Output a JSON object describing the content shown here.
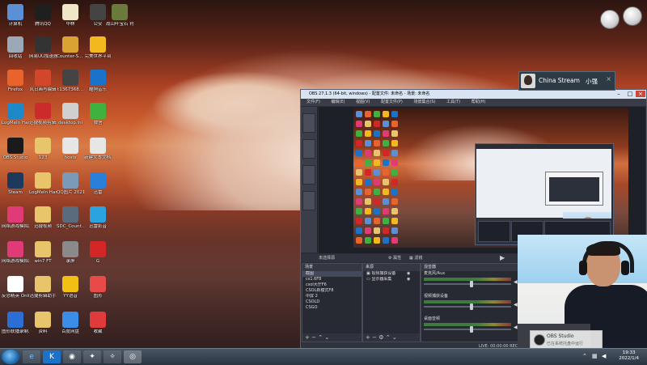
{
  "desktop_icons": [
    {
      "label": "计算机",
      "icon": "computer-icon",
      "color": "#5b8fd6"
    },
    {
      "label": "腾讯QQ",
      "icon": "qq-icon",
      "color": "#1f1f1f"
    },
    {
      "label": "中林",
      "icon": "doc-icon",
      "color": "#f0e6c8"
    },
    {
      "label": "公安",
      "icon": "app-icon",
      "color": "#444"
    },
    {
      "label": "战山叶宝石 衬面.png",
      "icon": "image-icon",
      "color": "#6a7a3a"
    },
    {
      "label": "回收站",
      "icon": "recycle-bin-icon",
      "color": "#9aa8b8"
    },
    {
      "label": "网易UU加速器",
      "icon": "uu-icon",
      "color": "#333"
    },
    {
      "label": "Counter-S... Global Off...",
      "icon": "csgo-icon",
      "color": "#d9a233"
    },
    {
      "label": "完美世界平台",
      "icon": "perfect-world-icon",
      "color": "#f2b81e"
    },
    {
      "label": "Firefox",
      "icon": "firefox-icon",
      "color": "#e8642c"
    },
    {
      "label": "风日画与编辑",
      "icon": "paint-icon",
      "color": "#d2472c"
    },
    {
      "label": "t1367368...",
      "icon": "image-icon",
      "color": "#444"
    },
    {
      "label": "酷狗音乐",
      "icon": "kugou-icon",
      "color": "#1a73c9"
    },
    {
      "label": "LogMeIn Hamachi",
      "icon": "hamachi-icon",
      "color": "#1e88c9"
    },
    {
      "label": "迅捷视频剪辑软件",
      "icon": "video-edit-icon",
      "color": "#cc2b2b"
    },
    {
      "label": "desktop.ini",
      "icon": "file-icon",
      "color": "#d0d0d0"
    },
    {
      "label": "微信",
      "icon": "wechat-icon",
      "color": "#3fb13f"
    },
    {
      "label": "OBS Studio",
      "icon": "obs-icon",
      "color": "#1a1a1a"
    },
    {
      "label": "123",
      "icon": "folder-icon",
      "color": "#e8c46a"
    },
    {
      "label": "hosts",
      "icon": "file-icon",
      "color": "#e6e6e6"
    },
    {
      "label": "新建文本文档.txt",
      "icon": "text-file-icon",
      "color": "#e6e6e6"
    },
    {
      "label": "Steam",
      "icon": "steam-icon",
      "color": "#1d3a5c"
    },
    {
      "label": "LogMeIn Hamachi",
      "icon": "hamachi-icon",
      "color": "#e8c46a"
    },
    {
      "label": "QQ图片 20211212...",
      "icon": "image-icon",
      "color": "#7a9ab8"
    },
    {
      "label": "迅雷",
      "icon": "xunlei-icon",
      "color": "#2a7fd8"
    },
    {
      "label": "网络游戏模拟器工具",
      "icon": "game-tool-icon",
      "color": "#e03a77"
    },
    {
      "label": "迅捷视频",
      "icon": "folder-icon",
      "color": "#e8c46a"
    },
    {
      "label": "SDC_Count... Online",
      "icon": "cs-online-icon",
      "color": "#5a6b7d"
    },
    {
      "label": "迅雷影音",
      "icon": "xunlei-player-icon",
      "color": "#2aa3e0"
    },
    {
      "label": "网络游戏模拟器",
      "icon": "game-tool-icon",
      "color": "#e03a77"
    },
    {
      "label": "win7 FT",
      "icon": "folder-icon",
      "color": "#e8c46a"
    },
    {
      "label": "录屏",
      "icon": "record-icon",
      "color": "#8a8a8a"
    },
    {
      "label": "G",
      "icon": "g-app-icon",
      "color": "#d42626"
    },
    {
      "label": "反恐精英 Online",
      "icon": "cs-online-icon",
      "color": "#ffffff"
    },
    {
      "label": "迅捷剪辑助手",
      "icon": "folder-icon",
      "color": "#e8c46a"
    },
    {
      "label": "YY语音",
      "icon": "yy-icon",
      "color": "#f2c014"
    },
    {
      "label": "图形",
      "icon": "paint-icon",
      "color": "#e84a4a"
    },
    {
      "label": "图形联播录制工具",
      "icon": "ocam-icon",
      "color": "#2b6ed4"
    },
    {
      "label": "资料",
      "icon": "folder-icon",
      "color": "#e8c46a"
    },
    {
      "label": "百度网盘",
      "icon": "baidu-pan-icon",
      "color": "#3a8ee8"
    },
    {
      "label": "收藏",
      "icon": "collection-icon",
      "color": "#e03a3a"
    }
  ],
  "tray_widgets": [
    "orb-widget-icon",
    "clean-ball-icon"
  ],
  "chat_toast": {
    "name": "China Stream",
    "extra": "小强",
    "close": "×"
  },
  "obs": {
    "title": "OBS 27.1.3 (64-bit, windows) - 配置文件: 未命名 - 场景: 未命名",
    "menu": [
      "文件(F)",
      "编辑(E)",
      "视图(V)",
      "配置文件(P)",
      "场景集合(S)",
      "工具(T)",
      "帮助(H)"
    ],
    "source_bar": {
      "label": "未选择源",
      "props": "⚙ 属性",
      "filters": "▦ 滤镜"
    },
    "scenes": {
      "header": "场景",
      "items": [
        "截图",
        "cs1.6F8",
        "csol大厅F6",
        "CSOL新模式F8",
        "中屏 2",
        "CSOLD",
        "CSGO"
      ],
      "selected": 0
    },
    "sources": {
      "header": "来源",
      "items": [
        "视频捕获设备",
        "显示器采集"
      ]
    },
    "mixer": {
      "header": "混音器",
      "channels": [
        {
          "name": "麦克风/Aux",
          "level": 0.55
        },
        {
          "name": "视频捕获设备",
          "level": 0.55
        },
        {
          "name": "桌面音频",
          "level": 0.55
        }
      ]
    },
    "status": "LIVE: 00:00:00   REC: 00:00:00   CPU: 12%"
  },
  "obs_toast": {
    "title": "OBS Studio",
    "sub": "已在系统托盘中运行"
  },
  "taskbar": {
    "items": [
      "ie-icon",
      "kugou-icon",
      "steam-icon",
      "cs-online-icon",
      "csgo-icon",
      "obs-icon"
    ],
    "clock_time": "19:33",
    "clock_date": "2022/1/4"
  }
}
